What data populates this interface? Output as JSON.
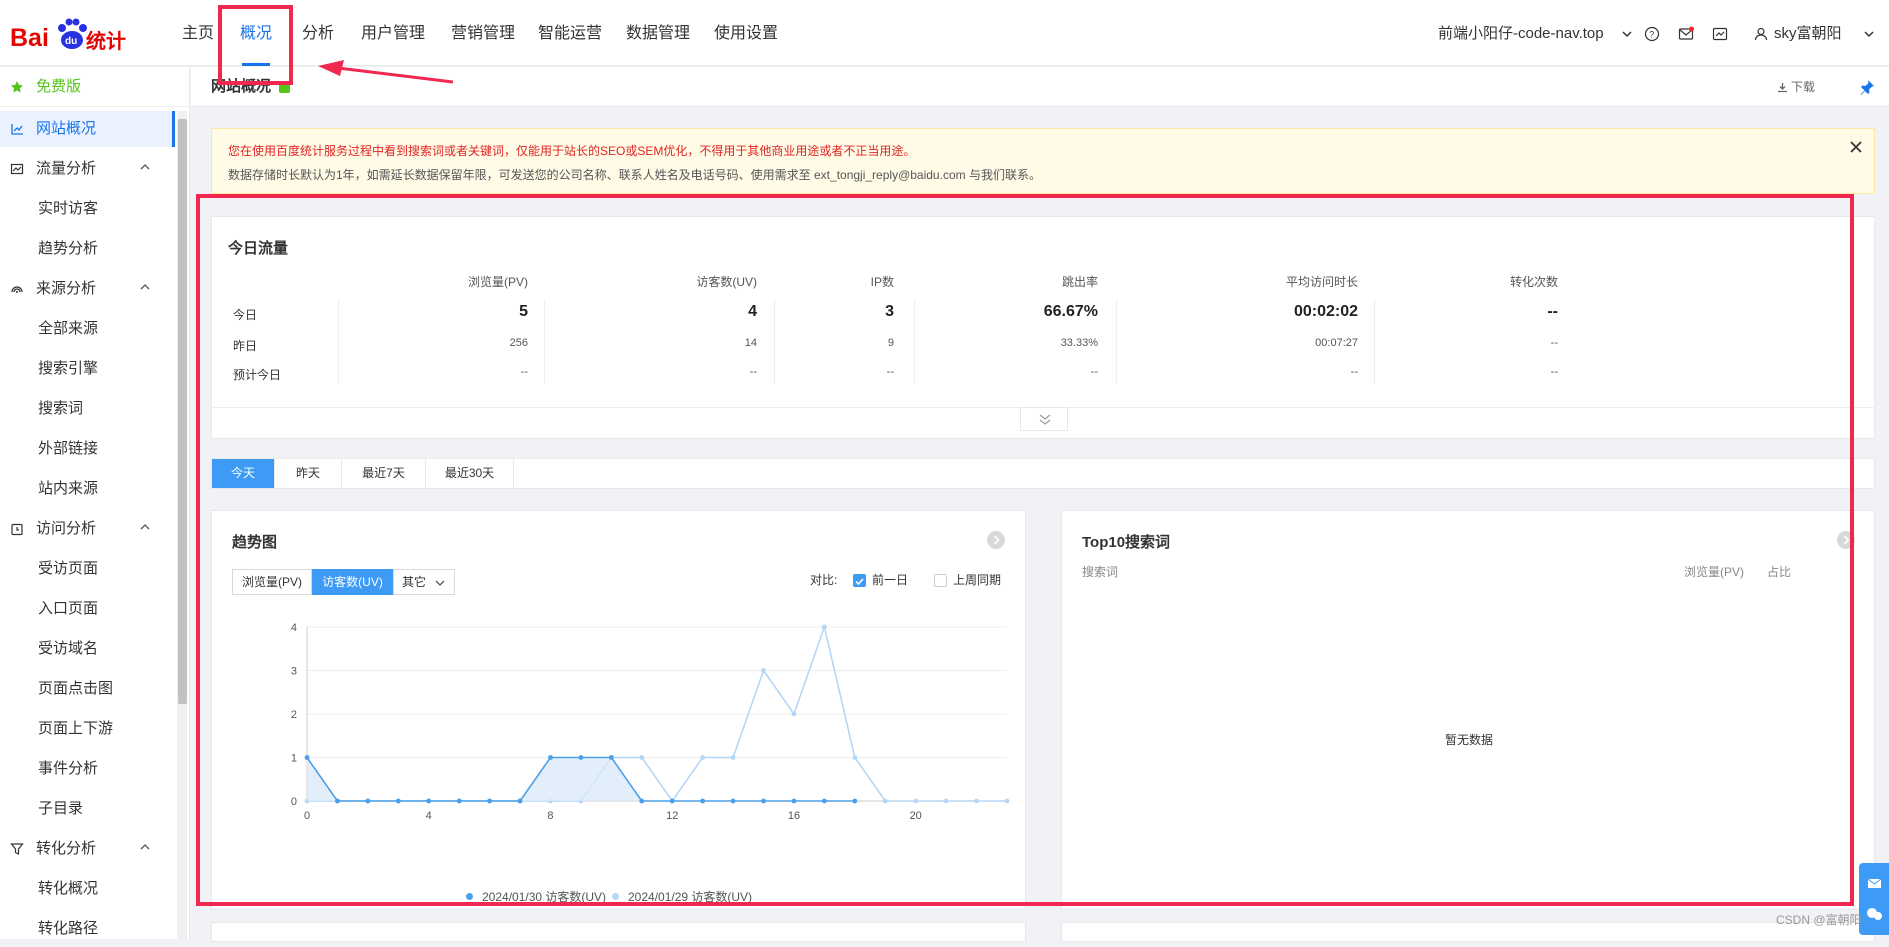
{
  "nav": {
    "items": [
      "主页",
      "概况",
      "分析",
      "用户管理",
      "营销管理",
      "智能运营",
      "数据管理",
      "使用设置"
    ],
    "active_index": 1,
    "site": "前端小阳仔-code-nav.top",
    "user": "sky富朝阳"
  },
  "sidebar": {
    "free_label": "免费版",
    "items": [
      {
        "label": "网站概况",
        "type": "group",
        "icon": "chart-line-icon",
        "active": true
      },
      {
        "label": "流量分析",
        "type": "group",
        "icon": "traffic-icon",
        "caret": true
      },
      {
        "label": "实时访客",
        "type": "sub"
      },
      {
        "label": "趋势分析",
        "type": "sub"
      },
      {
        "label": "来源分析",
        "type": "group",
        "icon": "source-icon",
        "caret": true
      },
      {
        "label": "全部来源",
        "type": "sub"
      },
      {
        "label": "搜索引擎",
        "type": "sub"
      },
      {
        "label": "搜索词",
        "type": "sub"
      },
      {
        "label": "外部链接",
        "type": "sub"
      },
      {
        "label": "站内来源",
        "type": "sub"
      },
      {
        "label": "访问分析",
        "type": "group",
        "icon": "visit-icon",
        "caret": true
      },
      {
        "label": "受访页面",
        "type": "sub"
      },
      {
        "label": "入口页面",
        "type": "sub"
      },
      {
        "label": "受访域名",
        "type": "sub"
      },
      {
        "label": "页面点击图",
        "type": "sub"
      },
      {
        "label": "页面上下游",
        "type": "sub"
      },
      {
        "label": "事件分析",
        "type": "sub"
      },
      {
        "label": "子目录",
        "type": "sub"
      },
      {
        "label": "转化分析",
        "type": "group",
        "icon": "funnel-icon",
        "caret": true
      },
      {
        "label": "转化概况",
        "type": "sub"
      },
      {
        "label": "转化路径",
        "type": "sub"
      }
    ]
  },
  "page": {
    "title": "网站概况",
    "download_label": "下载"
  },
  "notice": {
    "line1": "您在使用百度统计服务过程中看到搜索词或者关键词，仅能用于站长的SEO或SEM优化，不得用于其他商业用途或者不正当用途。",
    "line2": "数据存储时长默认为1年，如需延长数据保留年限，可发送您的公司名称、联系人姓名及电话号码、使用需求至 ext_tongji_reply@baidu.com 与我们联系。"
  },
  "traffic": {
    "title": "今日流量",
    "headers": [
      "浏览量(PV)",
      "访客数(UV)",
      "IP数",
      "跳出率",
      "平均访问时长",
      "转化次数"
    ],
    "rows": [
      {
        "label": "今日",
        "values": [
          "5",
          "4",
          "3",
          "66.67%",
          "00:02:02",
          "--"
        ]
      },
      {
        "label": "昨日",
        "values": [
          "256",
          "14",
          "9",
          "33.33%",
          "00:07:27",
          "--"
        ]
      },
      {
        "label": "预计今日",
        "values": [
          "--",
          "--",
          "--",
          "--",
          "--",
          "--"
        ]
      }
    ]
  },
  "date_tabs": {
    "items": [
      "今天",
      "昨天",
      "最近7天",
      "最近30天"
    ],
    "active_index": 0
  },
  "trend": {
    "title": "趋势图",
    "metric_tabs": [
      "浏览量(PV)",
      "访客数(UV)",
      "其它"
    ],
    "active_metric": 1,
    "compare_label": "对比:",
    "compare_options": [
      {
        "label": "前一日",
        "checked": true
      },
      {
        "label": "上周同期",
        "checked": false
      }
    ]
  },
  "chart_data": {
    "type": "area",
    "x": [
      0,
      1,
      2,
      3,
      4,
      5,
      6,
      7,
      8,
      9,
      10,
      11,
      12,
      13,
      14,
      15,
      16,
      17,
      18,
      19,
      20,
      21,
      22,
      23
    ],
    "x_ticks": [
      0,
      4,
      8,
      12,
      16,
      20
    ],
    "ylim": [
      0,
      4
    ],
    "y_ticks": [
      0,
      1,
      2,
      3,
      4
    ],
    "series": [
      {
        "name": "2024/01/30 访客数(UV)",
        "color": "#4a9fe8",
        "values": [
          1,
          0,
          0,
          0,
          0,
          0,
          0,
          0,
          1,
          1,
          1,
          0,
          0,
          0,
          0,
          0,
          0,
          0,
          0,
          null,
          null,
          null,
          null,
          null
        ]
      },
      {
        "name": "2024/01/29 访客数(UV)",
        "color": "#b5d7f7",
        "values": [
          0,
          0,
          0,
          0,
          0,
          0,
          0,
          0,
          0,
          0,
          1,
          1,
          0,
          1,
          1,
          3,
          2,
          4,
          1,
          0,
          0,
          0,
          0,
          0
        ]
      }
    ],
    "grid": true,
    "legend": "bottom"
  },
  "top10": {
    "title": "Top10搜索词",
    "col_keyword": "搜索词",
    "col_pv": "浏览量(PV)",
    "col_ratio": "占比",
    "empty": "暂无数据"
  },
  "watermark": "CSDN @富朝阳"
}
